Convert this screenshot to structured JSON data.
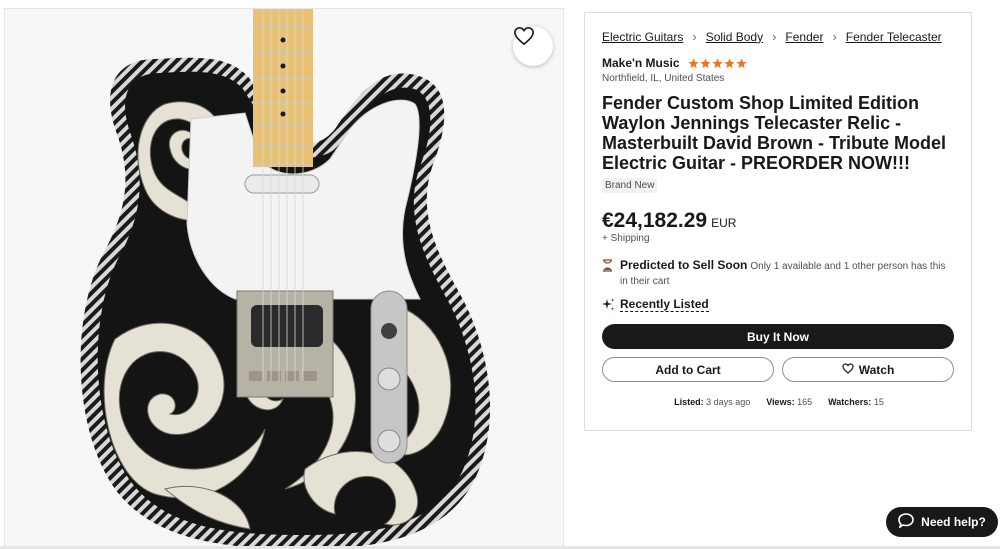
{
  "breadcrumb": [
    "Electric Guitars",
    "Solid Body",
    "Fender",
    "Fender Telecaster"
  ],
  "seller": {
    "name": "Make'n Music",
    "rating_stars": 5,
    "location": "Northfield, IL, United States"
  },
  "listing": {
    "title": "Fender Custom Shop Limited Edition Waylon Jennings Telecaster Relic - Masterbuilt David Brown - Tribute Model Electric Guitar - PREORDER NOW!!!",
    "condition": "Brand New",
    "price": "€24,182.29",
    "currency": "EUR",
    "shipping": "+ Shipping"
  },
  "predict": {
    "headline": "Predicted to Sell Soon",
    "detail": "Only 1 available and 1 other person has this in their cart"
  },
  "recently_listed": "Recently Listed",
  "buttons": {
    "buy": "Buy It Now",
    "cart": "Add to Cart",
    "watch": "Watch"
  },
  "stats": {
    "listed_label": "Listed:",
    "listed_value": "3 days ago",
    "views_label": "Views:",
    "views_value": "165",
    "watchers_label": "Watchers:",
    "watchers_value": "15"
  },
  "help": "Need help?",
  "colors": {
    "star": "#f2731c",
    "primary_button": "#191919",
    "text": "#191919"
  },
  "icons": {
    "favorite": "heart-outline-icon",
    "predict": "hourglass-icon",
    "recent": "sparkle-icon",
    "breadcrumb_separator": "chevron-right-icon",
    "help": "chat-bubble-icon"
  }
}
